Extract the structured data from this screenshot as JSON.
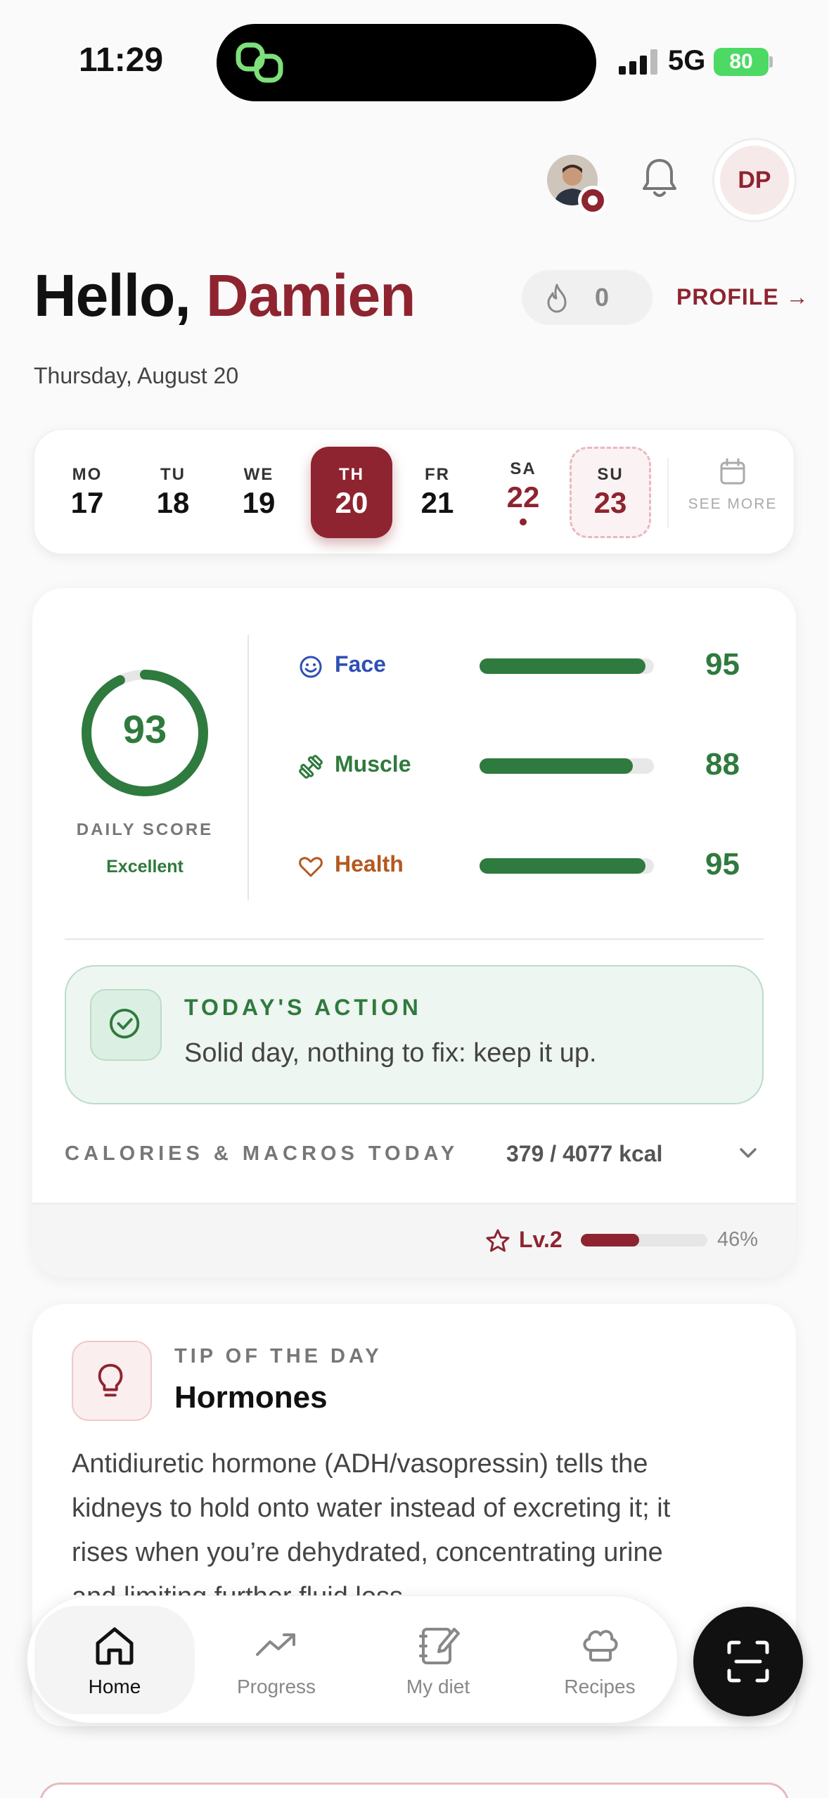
{
  "status": {
    "time": "11:29",
    "network": "5G",
    "battery": "80"
  },
  "header": {
    "avatar_initials": "DP",
    "streak_count": "0",
    "profile_link": "PROFILE →"
  },
  "greeting": {
    "hello": "Hello,",
    "name": "Damien",
    "date": "Thursday, August 20"
  },
  "week": {
    "days": [
      {
        "name": "MO",
        "date": "17"
      },
      {
        "name": "TU",
        "date": "18"
      },
      {
        "name": "WE",
        "date": "19"
      },
      {
        "name": "TH",
        "date": "20"
      },
      {
        "name": "FR",
        "date": "21"
      },
      {
        "name": "SA",
        "date": "22"
      },
      {
        "name": "SU",
        "date": "23"
      }
    ],
    "see_more": "SEE MORE"
  },
  "score": {
    "value": "93",
    "fraction": 0.93,
    "label": "DAILY SCORE",
    "rating": "Excellent",
    "metrics": [
      {
        "label": "Face",
        "value": "95",
        "fraction": 0.95,
        "color": "#2f4fb5",
        "icon": "smile-icon"
      },
      {
        "label": "Muscle",
        "value": "88",
        "fraction": 0.88,
        "color": "#2f7a3e",
        "icon": "dumbbell-icon"
      },
      {
        "label": "Health",
        "value": "95",
        "fraction": 0.95,
        "color": "#b4581e",
        "icon": "heart-icon"
      }
    ]
  },
  "action": {
    "title": "TODAY'S ACTION",
    "text": "Solid day, nothing to fix: keep it up."
  },
  "calories": {
    "label": "CALORIES & MACROS TODAY",
    "value": "379 / 4077 kcal"
  },
  "level": {
    "label": "Lv.2",
    "percent": "46%",
    "fraction": 0.46
  },
  "tip": {
    "kicker": "TIP OF THE DAY",
    "title": "Hormones",
    "body": "Antidiuretic hormone (ADH/vasopressin) tells the kidneys to hold onto water instead of excreting it; it rises when you’re dehydrated, concentrating urine and limiting further fluid loss."
  },
  "tabs": [
    {
      "label": "Home",
      "icon": "home-icon"
    },
    {
      "label": "Progress",
      "icon": "trend-icon"
    },
    {
      "label": "My diet",
      "icon": "notebook-icon"
    },
    {
      "label": "Recipes",
      "icon": "chef-hat-icon"
    }
  ],
  "colors": {
    "brand": "#8e2430",
    "good": "#2f7a3e"
  }
}
